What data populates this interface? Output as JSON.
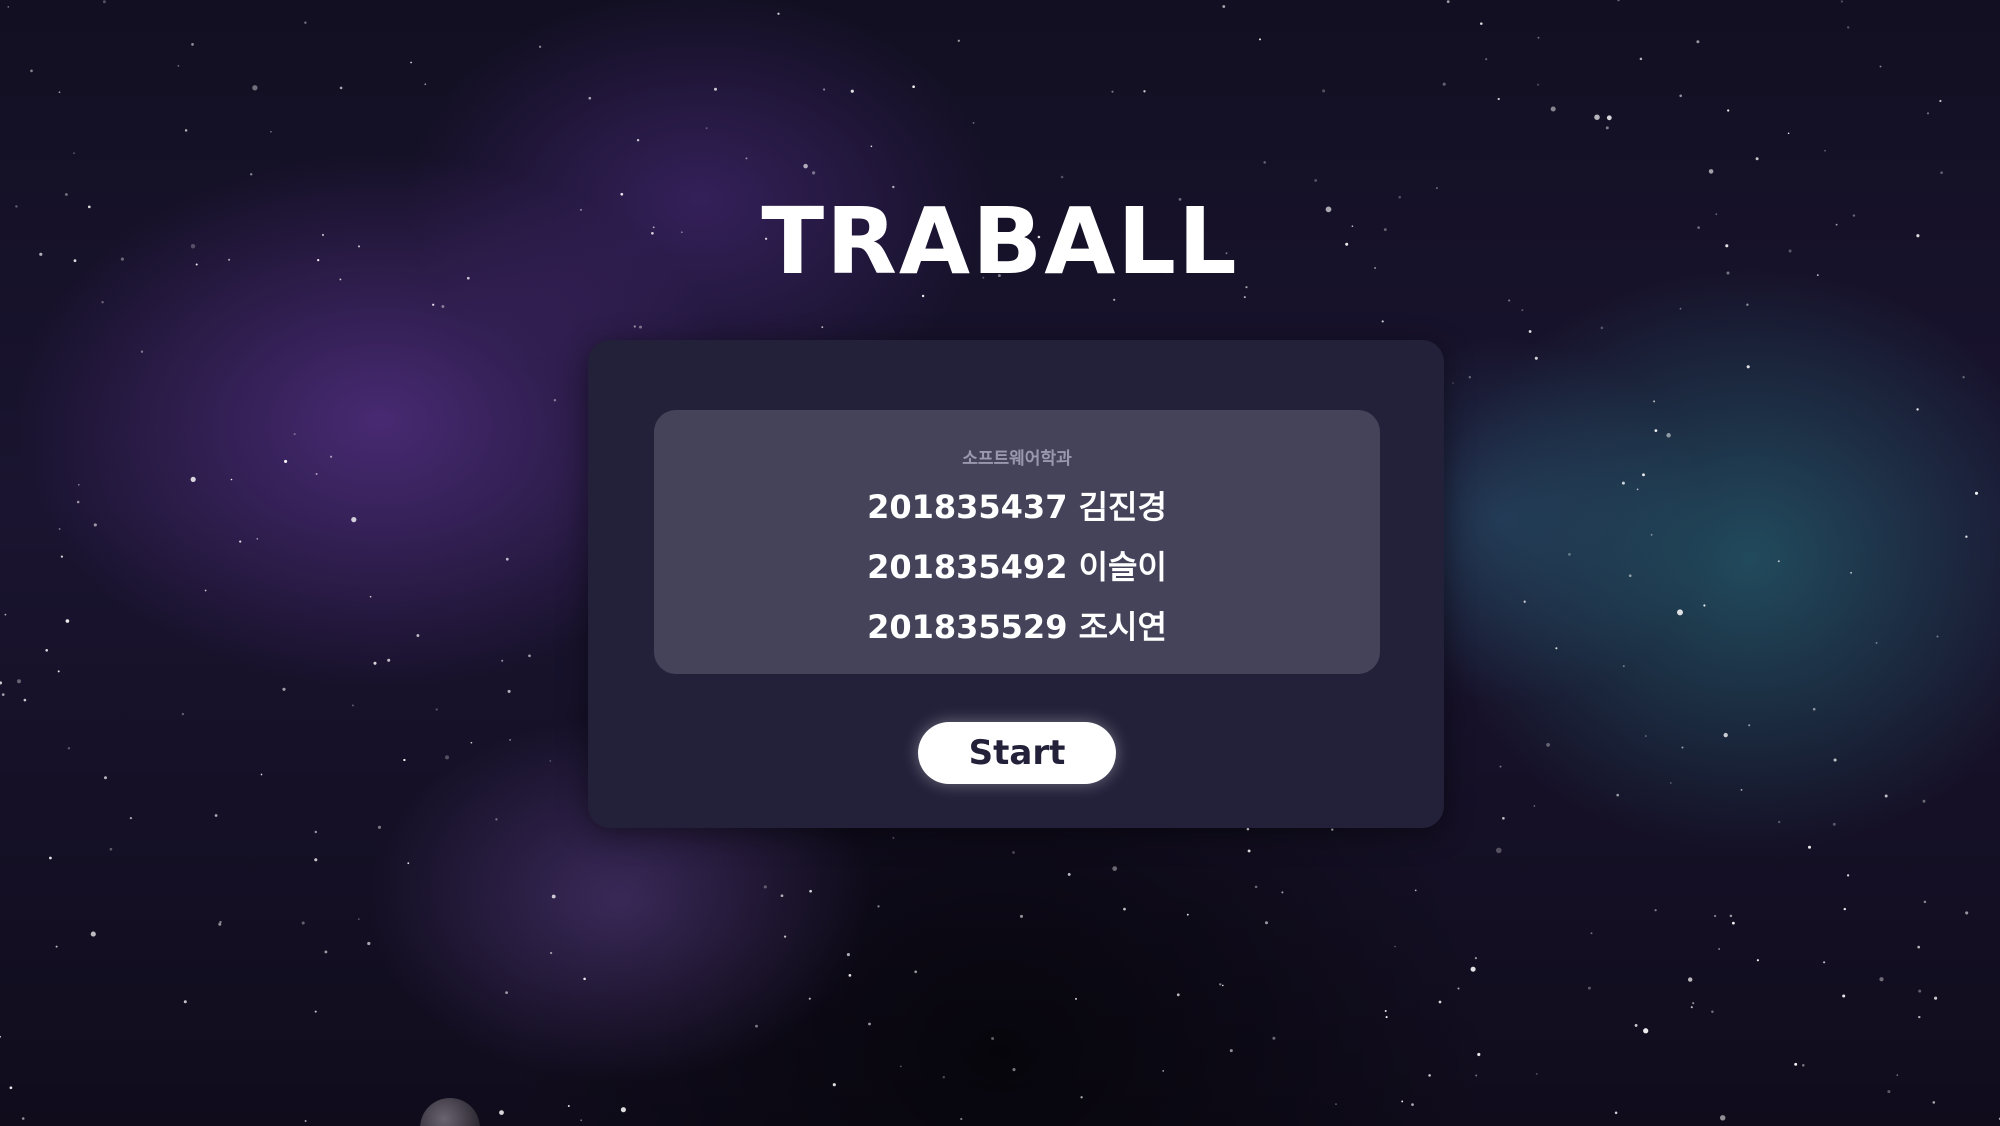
{
  "app": {
    "title": "TRABALL"
  },
  "info": {
    "department": "소프트웨어학과",
    "members": [
      {
        "id": "201835437",
        "name": "김진경"
      },
      {
        "id": "201835492",
        "name": "이슬이"
      },
      {
        "id": "201835529",
        "name": "조시연"
      }
    ]
  },
  "actions": {
    "start_label": "Start"
  },
  "colors": {
    "panel": "#23213a",
    "card": "#44435a",
    "button": "#ffffff",
    "button_text": "#23213a",
    "text": "#ffffff",
    "subtext": "#9a98ad"
  }
}
